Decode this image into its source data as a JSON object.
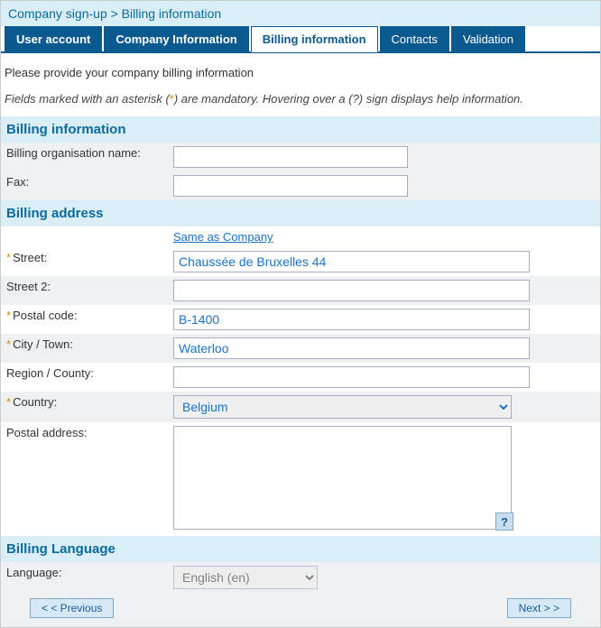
{
  "breadcrumb": "Company sign-up > Billing information",
  "tabs": [
    {
      "label": "User account"
    },
    {
      "label": "Company Information"
    },
    {
      "label": "Billing information"
    },
    {
      "label": "Contacts"
    },
    {
      "label": "Validation"
    }
  ],
  "intro": "Please provide your company billing information",
  "note_pre": "Fields marked with an asterisk (",
  "note_ast": "*",
  "note_post": ") are mandatory. Hovering over a (?) sign displays help information.",
  "sections": {
    "billing_info": "Billing information",
    "billing_addr": "Billing address",
    "billing_lang": "Billing Language"
  },
  "labels": {
    "org_name": "Billing organisation name:",
    "fax": "Fax:",
    "same_as": "Same as Company",
    "street": "Street:",
    "street2": "Street 2:",
    "postal": "Postal code:",
    "city": "City / Town:",
    "region": "Region / County:",
    "country": "Country:",
    "postal_addr": "Postal address:",
    "language": "Language:"
  },
  "values": {
    "org_name": "",
    "fax": "",
    "street": "Chaussée de Bruxelles 44",
    "street2": "",
    "postal": "B-1400",
    "city": "Waterloo",
    "region": "",
    "country": "Belgium",
    "postal_addr": "",
    "language": "English (en)"
  },
  "help": "?",
  "nav": {
    "prev": "< < Previous",
    "next": "Next > >"
  }
}
